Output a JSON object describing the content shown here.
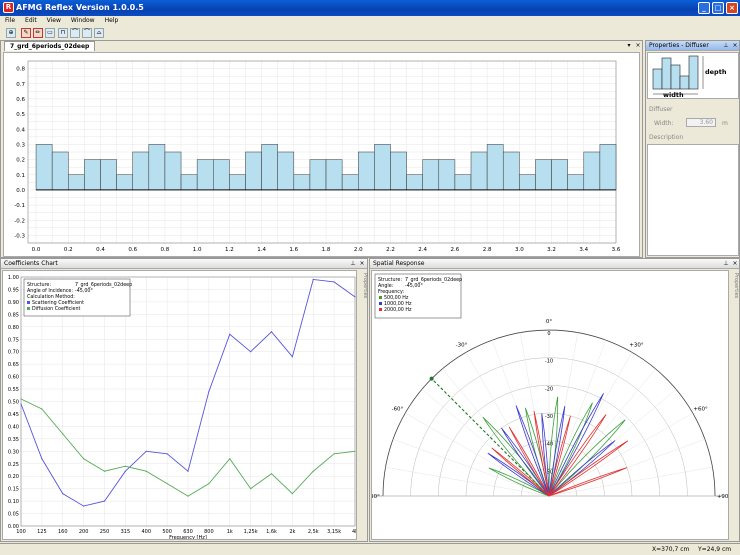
{
  "window": {
    "title": "AFMG Reflex Version 1.0.0.5",
    "minimize": "_",
    "maximize": "□",
    "close": "×"
  },
  "menu": [
    "File",
    "Edit",
    "View",
    "Window",
    "Help"
  ],
  "structure_tab": {
    "label": "7_grd_6periods_02deep"
  },
  "structure": {
    "x_ticks": [
      "0.0",
      "0.2",
      "0.4",
      "0.6",
      "0.8",
      "1.0",
      "1.2",
      "1.4",
      "1.6",
      "1.8",
      "2.0",
      "2.2",
      "2.4",
      "2.6",
      "2.8",
      "3.0",
      "3.2",
      "3.4",
      "3.6"
    ],
    "y_ticks": [
      "0.8",
      "0.7",
      "0.6",
      "0.5",
      "0.4",
      "0.3",
      "0.2",
      "0.1",
      "0.0",
      "-0.1",
      "-0.2",
      "-0.3"
    ],
    "well_width_m": 0.1,
    "depths": [
      0.3,
      0.25,
      0.1,
      0.2,
      0.2,
      0.1,
      0.25,
      0.3,
      0.25,
      0.1,
      0.2,
      0.2,
      0.1,
      0.25,
      0.3,
      0.25,
      0.1,
      0.2,
      0.2,
      0.1,
      0.25,
      0.3,
      0.25,
      0.1,
      0.2,
      0.2,
      0.1,
      0.25,
      0.3,
      0.25,
      0.1,
      0.2,
      0.2,
      0.1,
      0.25,
      0.3
    ],
    "fill": "#b7dff0"
  },
  "properties": {
    "title": "Properties - Diffuser",
    "depth_label": "depth",
    "width_label": "width",
    "section_diffuser": "Diffuser",
    "width_field_label": "Width:",
    "width_value": "3.60",
    "width_unit": "m",
    "section_description": "Description"
  },
  "coeff_panel": {
    "title": "Coefficients Chart",
    "side_tab": "Properties"
  },
  "spatial_panel": {
    "title": "Spatial Response",
    "side_tab": "Properties"
  },
  "chart_data": [
    {
      "type": "line",
      "info": {
        "structure_label": "Structure:",
        "structure": "7_grd_6periods_02deep",
        "angle_label": "Angle of Incidence:",
        "angle": "-45,00°",
        "calc_label": "Calculation Method:"
      },
      "categories": [
        "100",
        "125",
        "160",
        "200",
        "250",
        "315",
        "400",
        "500",
        "630",
        "800",
        "1k",
        "1,25k",
        "1,6k",
        "2k",
        "2,5k",
        "3,15k",
        "4k"
      ],
      "series": [
        {
          "name": "Scattering Coefficient",
          "color": "#5555dd",
          "values": [
            0.49,
            0.27,
            0.13,
            0.08,
            0.1,
            0.22,
            0.3,
            0.29,
            0.22,
            0.54,
            0.77,
            0.7,
            0.78,
            0.68,
            0.99,
            0.98,
            0.92
          ]
        },
        {
          "name": "Diffusion Coefficient",
          "color": "#55aa55",
          "values": [
            0.51,
            0.47,
            0.37,
            0.27,
            0.22,
            0.24,
            0.22,
            0.17,
            0.12,
            0.17,
            0.27,
            0.15,
            0.21,
            0.13,
            0.22,
            0.29,
            0.3
          ]
        }
      ],
      "xlabel": "Frequency [Hz]",
      "ylim": [
        0,
        1
      ],
      "y_ticks": [
        "1.00",
        "0.95",
        "0.90",
        "0.85",
        "0.80",
        "0.75",
        "0.70",
        "0.65",
        "0.60",
        "0.55",
        "0.50",
        "0.45",
        "0.40",
        "0.35",
        "0.30",
        "0.25",
        "0.20",
        "0.15",
        "0.10",
        "0.05",
        "0.00"
      ]
    },
    {
      "type": "polar",
      "info": {
        "structure_label": "Structure:",
        "structure": "7_grd_6periods_02deep",
        "angle_label": "Angle:",
        "angle": "-45,00°",
        "freq_label": "Frequency:"
      },
      "series": [
        {
          "name": "500,00 Hz",
          "color": "#3aa03a"
        },
        {
          "name": "1000,00 Hz",
          "color": "#3a3ad0"
        },
        {
          "name": "2000,00 Hz",
          "color": "#e03030"
        }
      ],
      "angle_labels": [
        "-90°",
        "-60°",
        "-30°",
        "0°",
        "+30°",
        "+60°",
        "+90°"
      ],
      "radial_labels": [
        "0",
        "-10",
        "-20",
        "-30",
        "-40",
        "-50"
      ]
    }
  ],
  "status": {
    "x": "X=370,7 cm",
    "y": "Y=24,9 cm"
  }
}
